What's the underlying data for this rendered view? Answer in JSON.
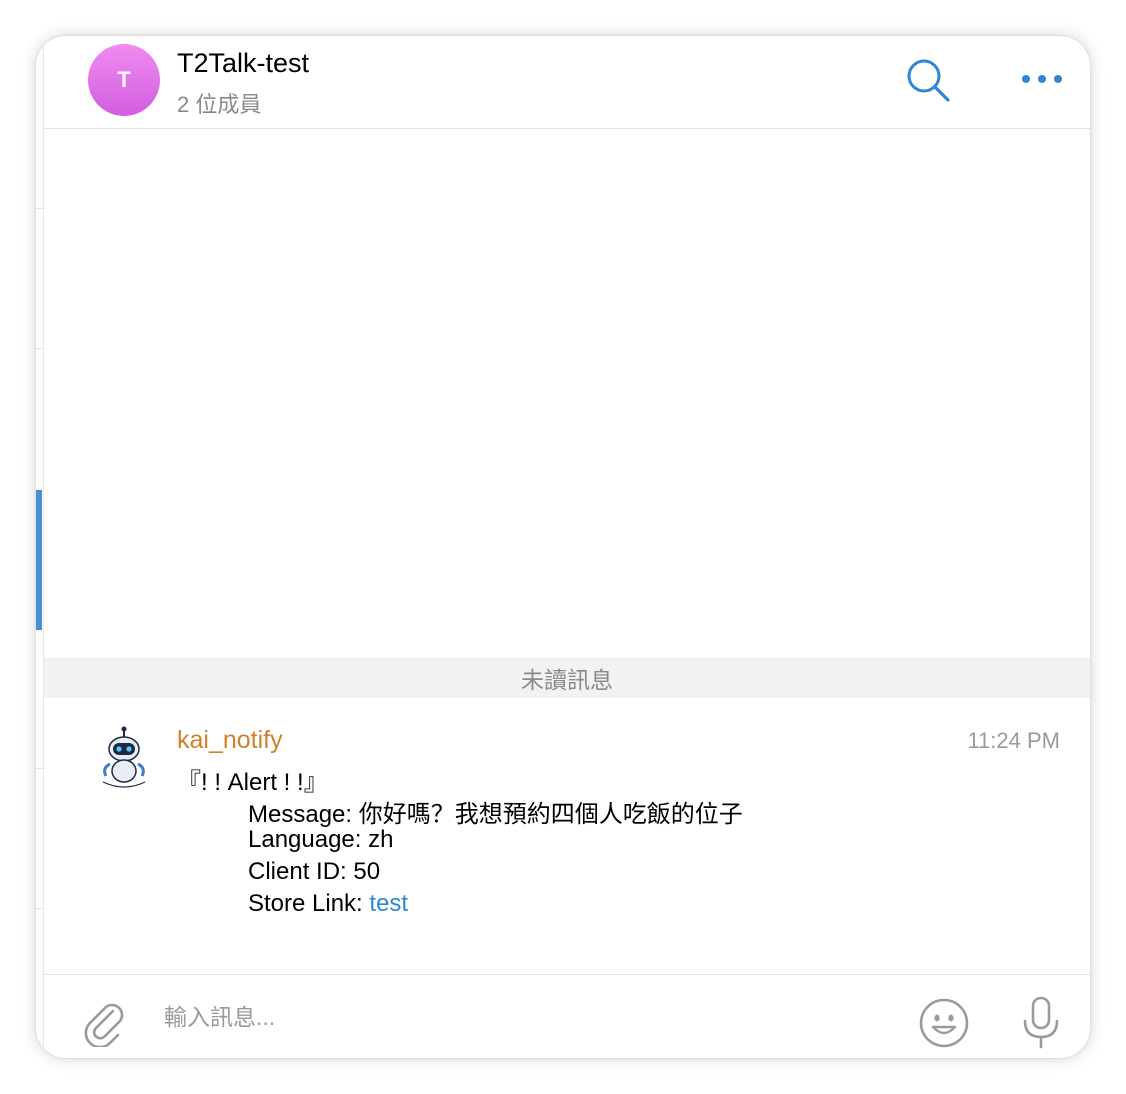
{
  "header": {
    "avatar_initial": "T",
    "title": "T2Talk-test",
    "subtitle": "2 位成員",
    "icons": {
      "search": "search-icon",
      "more": "more-dots-icon"
    }
  },
  "unread_divider": "未讀訊息",
  "message": {
    "sender": "kai_notify",
    "time": "11:24 PM",
    "avatar_icon": "robot-avatar-icon",
    "alert_line": "『! ! Alert ! !』",
    "message_line": "Message: 你好嗎？我想預約四個人吃飯的位子",
    "language_line": "Language: zh",
    "client_line": "Client ID: 50",
    "store_label": "Store Link: ",
    "store_link_text": "test"
  },
  "composer": {
    "placeholder": "輸入訊息...",
    "icons": {
      "attach": "paperclip-icon",
      "emoji": "smile-icon",
      "mic": "microphone-icon"
    }
  },
  "colors": {
    "accent": "#2f86d1",
    "sender": "#d27f2e",
    "avatar_gradient_top": "#f08bf0",
    "avatar_gradient_bottom": "#d35de0",
    "active_strip": "#4a8fd0"
  }
}
